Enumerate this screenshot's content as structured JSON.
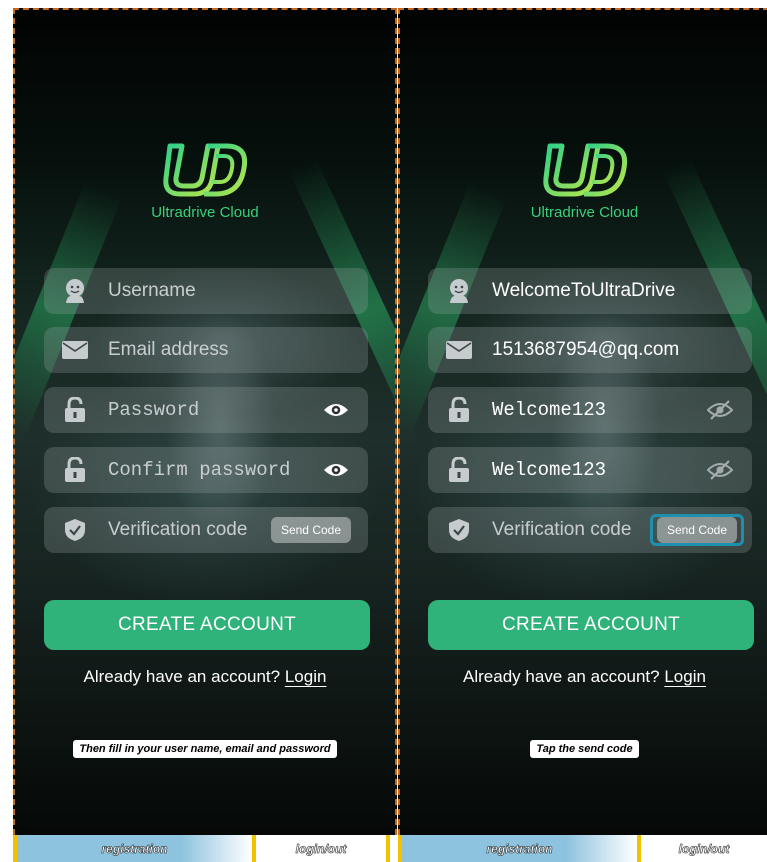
{
  "app": {
    "logo_text": "Ultradrive Cloud",
    "accent": "#2fb37a",
    "logo_color": "#37d07a"
  },
  "left": {
    "username_placeholder": "Username",
    "email_placeholder": "Email address",
    "password_placeholder": "Password",
    "confirm_placeholder": "Confirm password",
    "verification_placeholder": "Verification code",
    "send_code_label": "Send Code",
    "create_label": "CREATE ACCOUNT",
    "already_text": "Already have an account? ",
    "login_label": "Login",
    "caption": "Then fill in your user name, email and password"
  },
  "right": {
    "username_value": "WelcomeToUltraDrive",
    "email_value": "1513687954@qq.com",
    "password_value": "Welcome123",
    "confirm_value": "Welcome123",
    "verification_placeholder": "Verification code",
    "send_code_label": "Send Code",
    "create_label": "CREATE ACCOUNT",
    "already_text": "Already have an account? ",
    "login_label": "Login",
    "caption": "Tap the send code"
  },
  "bottom_tabs": {
    "registration": "registration",
    "login_out": "login/out"
  },
  "icons": {
    "user": "user-face-icon",
    "email": "envelope-icon",
    "lock": "lock-icon",
    "shield": "shield-check-icon",
    "eye_open": "eye-icon",
    "eye_closed": "eye-off-icon"
  }
}
